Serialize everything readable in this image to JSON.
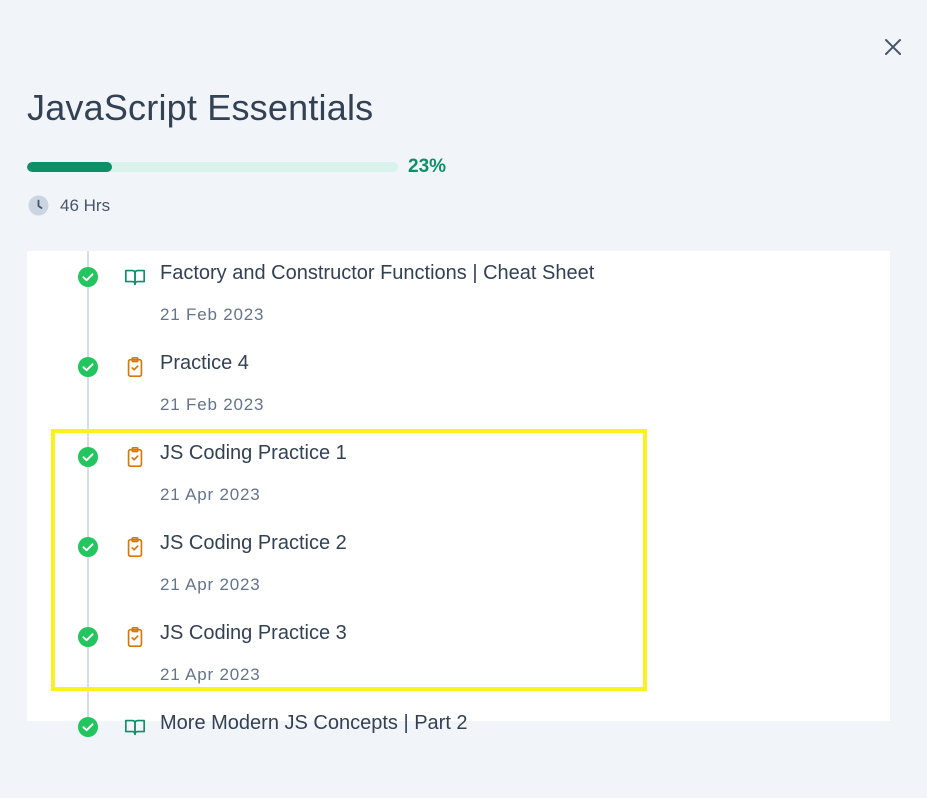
{
  "course": {
    "title": "JavaScript Essentials",
    "progress_label": "23%",
    "progress_fraction": 0.23,
    "duration": "46 Hrs"
  },
  "items": [
    {
      "title": "Factory and Constructor Functions | Cheat Sheet",
      "date": "21 Feb 2023",
      "icon": "book-icon",
      "completed": true
    },
    {
      "title": "Practice 4",
      "date": "21 Feb 2023",
      "icon": "clipboard-check-icon",
      "completed": true
    },
    {
      "title": "JS Coding Practice 1",
      "date": "21 Apr 2023",
      "icon": "clipboard-check-icon",
      "completed": true
    },
    {
      "title": "JS Coding Practice 2",
      "date": "21 Apr 2023",
      "icon": "clipboard-check-icon",
      "completed": true
    },
    {
      "title": "JS Coding Practice 3",
      "date": "21 Apr 2023",
      "icon": "clipboard-check-icon",
      "completed": true
    },
    {
      "title": "More Modern JS Concepts | Part 2",
      "date": "",
      "icon": "book-icon",
      "completed": true
    }
  ],
  "colors": {
    "accent": "#0f8f68",
    "check": "#22c55e",
    "book_icon": "#0f8f68",
    "practice_icon": "#d97706",
    "highlight": "#fbf11c"
  }
}
